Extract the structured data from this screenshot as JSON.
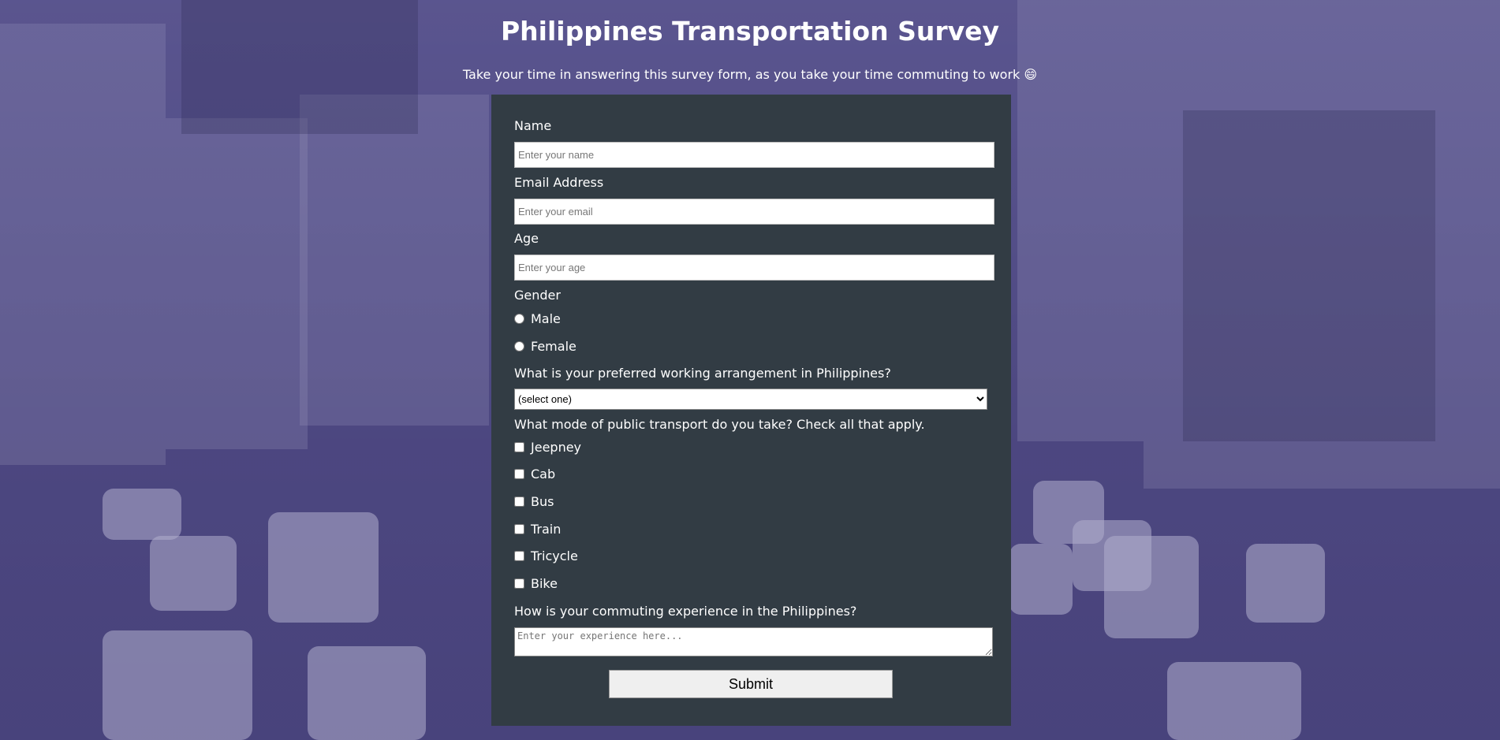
{
  "header": {
    "title": "Philippines Transportation Survey",
    "description": "Take your time in answering this survey form, as you take your time commuting to work 😄"
  },
  "form": {
    "name": {
      "label": "Name",
      "placeholder": "Enter your name"
    },
    "email": {
      "label": "Email Address",
      "placeholder": "Enter your email"
    },
    "age": {
      "label": "Age",
      "placeholder": "Enter your age"
    },
    "gender": {
      "label": "Gender",
      "options": [
        "Male",
        "Female"
      ]
    },
    "arrangement": {
      "label": "What is your preferred working arrangement in Philippines?",
      "selected": "(select one)"
    },
    "transport": {
      "label": "What mode of public transport do you take? Check all that apply.",
      "options": [
        "Jeepney",
        "Cab",
        "Bus",
        "Train",
        "Tricycle",
        "Bike"
      ]
    },
    "experience": {
      "label": "How is your commuting experience in the Philippines?",
      "placeholder": "Enter your experience here..."
    },
    "submit_label": "Submit"
  },
  "colors": {
    "form_background": "#323c44",
    "overlay": "#483c8c"
  }
}
